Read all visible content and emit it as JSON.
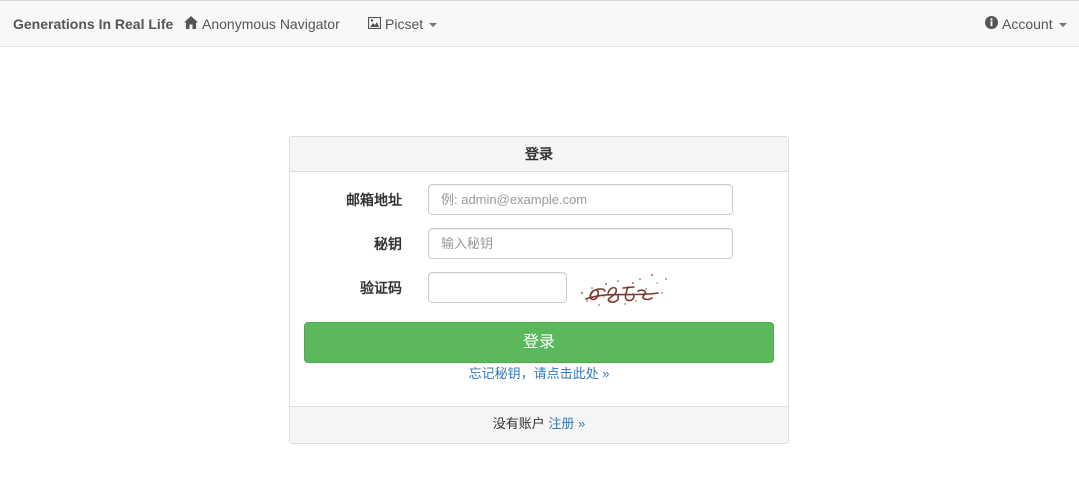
{
  "navbar": {
    "brand": "Generations In Real Life",
    "anonymous_navigator": "Anonymous Navigator",
    "picset": "Picset",
    "account": "Account"
  },
  "login": {
    "heading": "登录",
    "email_label": "邮箱地址",
    "email_placeholder": "例: admin@example.com",
    "password_label": "秘钥",
    "password_placeholder": "输入秘钥",
    "captcha_label": "验证码",
    "captcha_value": "",
    "submit_label": "登录",
    "forgot_text": "忘记秘钥，请点击此处 »",
    "no_account_text": "没有账户",
    "register_link": "注册 »"
  },
  "icons": {
    "home": "home-icon",
    "picture": "picture-icon",
    "info": "info-icon"
  },
  "colors": {
    "navbar_bg": "#f8f8f8",
    "primary_button": "#5cb85c",
    "link": "#337ab7",
    "panel_heading_bg": "#f5f5f5"
  }
}
